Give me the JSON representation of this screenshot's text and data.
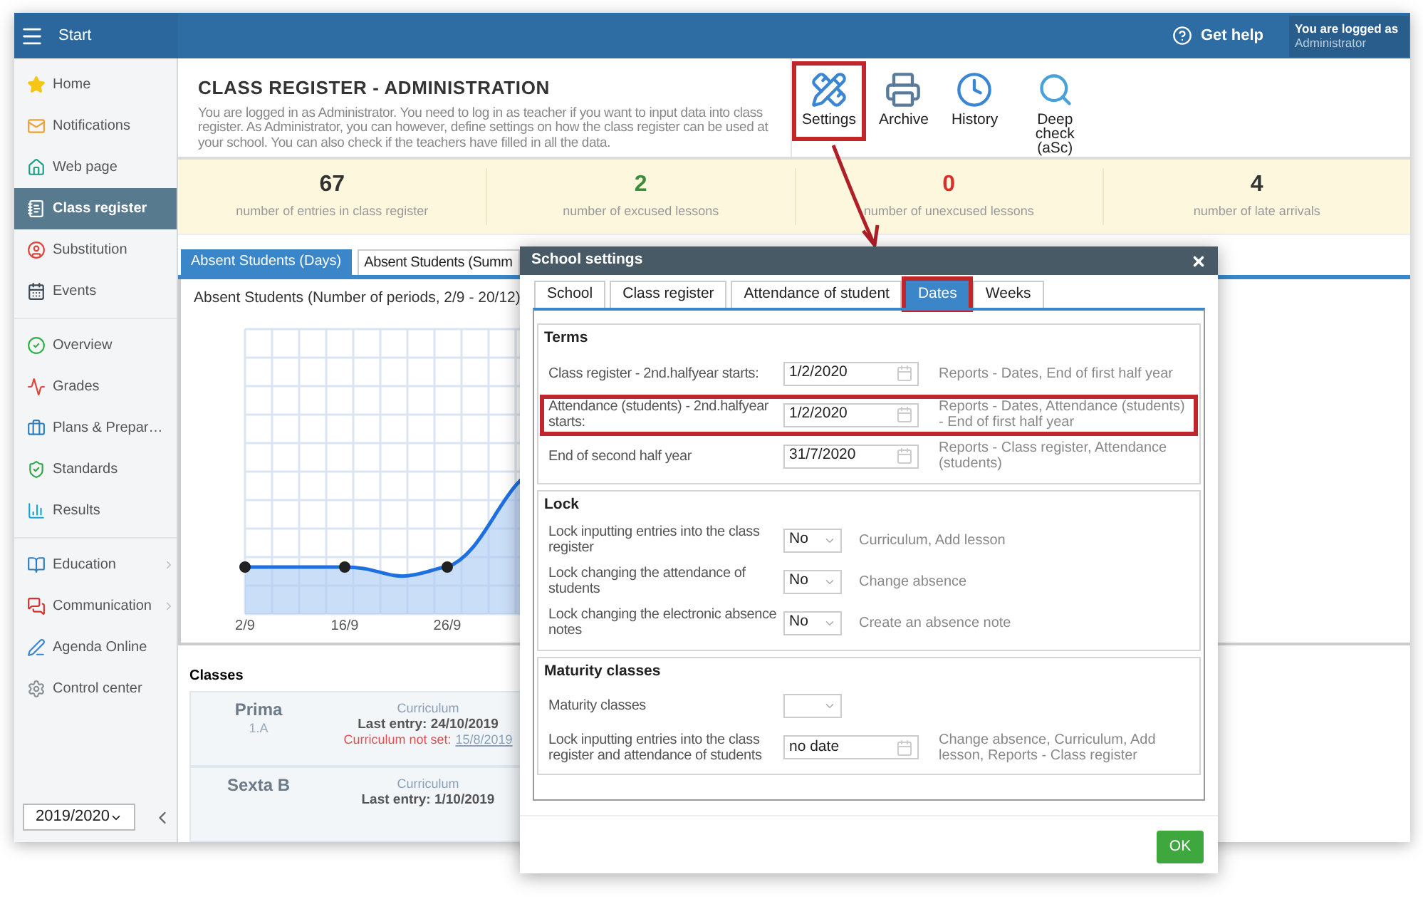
{
  "app_bar": {
    "title": "Start",
    "help": "Get help",
    "login_label": "You are logged as",
    "login_user": "Administrator"
  },
  "sidebar": {
    "groups": [
      [
        {
          "label": "Home",
          "selected": false,
          "has_submenu": false
        },
        {
          "label": "Notifications",
          "selected": false,
          "has_submenu": false
        },
        {
          "label": "Web page",
          "selected": false,
          "has_submenu": false
        },
        {
          "label": "Class register",
          "selected": true,
          "has_submenu": false
        },
        {
          "label": "Substitution",
          "selected": false,
          "has_submenu": false
        },
        {
          "label": "Events",
          "selected": false,
          "has_submenu": false
        }
      ],
      [
        {
          "label": "Overview",
          "selected": false,
          "has_submenu": false
        },
        {
          "label": "Grades",
          "selected": false,
          "has_submenu": false
        },
        {
          "label": "Plans & Prepar…",
          "selected": false,
          "has_submenu": false
        },
        {
          "label": "Standards",
          "selected": false,
          "has_submenu": false
        },
        {
          "label": "Results",
          "selected": false,
          "has_submenu": false
        }
      ],
      [
        {
          "label": "Education",
          "selected": false,
          "has_submenu": true
        },
        {
          "label": "Communication",
          "selected": false,
          "has_submenu": true
        },
        {
          "label": "Agenda Online",
          "selected": false,
          "has_submenu": false
        },
        {
          "label": "Control center",
          "selected": false,
          "has_submenu": false
        }
      ]
    ],
    "year": "2019/2020"
  },
  "header": {
    "title": "CLASS REGISTER - ADMINISTRATION",
    "description": "You are logged in as Administrator. You need to log in as teacher if you want to input data into class register. As Administrator, you can however, define settings on how the class register can be used at your school. You can also check if the teachers have filled in all the data.",
    "tools": [
      {
        "label": "Settings",
        "highlighted": true
      },
      {
        "label": "Archive",
        "highlighted": false
      },
      {
        "label": "History",
        "highlighted": false
      },
      {
        "label": "Deep check (aSc)",
        "highlighted": false
      }
    ]
  },
  "stats": [
    {
      "value": "67",
      "label": "number of entries in class register",
      "color": "#333333"
    },
    {
      "value": "2",
      "label": "number of excused lessons",
      "color": "#3c8c3c"
    },
    {
      "value": "0",
      "label": "number of unexcused lessons",
      "color": "#d9302c"
    },
    {
      "value": "4",
      "label": "number of late arrivals",
      "color": "#333333"
    }
  ],
  "tabs": [
    {
      "label": "Absent Students (Days)",
      "selected": true
    },
    {
      "label": "Absent Students (Summ",
      "selected": false
    }
  ],
  "chart": {
    "title": "Absent Students (Number of periods, 2/9 - 20/12)",
    "x_labels": [
      "2/9",
      "16/9",
      "26/9"
    ]
  },
  "classes": {
    "title": "Classes",
    "rows": [
      {
        "name": "Prima",
        "code": "1.A",
        "type": "Curriculum",
        "last_entry": "Last entry: 24/10/2019",
        "warning": "Curriculum not set:",
        "warning_link": "15/8/2019"
      },
      {
        "name": "Sexta B",
        "type": "Curriculum",
        "last_entry": "Last entry: 1/10/2019"
      }
    ]
  },
  "dialog": {
    "title": "School settings",
    "tabs": [
      {
        "label": "School",
        "selected": false,
        "highlighted": false
      },
      {
        "label": "Class register",
        "selected": false,
        "highlighted": false
      },
      {
        "label": "Attendance of student",
        "selected": false,
        "highlighted": false
      },
      {
        "label": "Dates",
        "selected": true,
        "highlighted": true
      },
      {
        "label": "Weeks",
        "selected": false,
        "highlighted": false
      }
    ],
    "sections": [
      {
        "title": "Terms",
        "rows": [
          {
            "kind": "date",
            "label": "Class register - 2nd.halfyear starts:",
            "value": "1/2/2020",
            "note": "Reports - Dates, End of first half year",
            "highlighted": false
          },
          {
            "kind": "date",
            "label": "Attendance (students) - 2nd.halfyear starts:",
            "value": "1/2/2020",
            "note": "Reports - Dates, Attendance (students) - End of first half year",
            "highlighted": true
          },
          {
            "kind": "date",
            "label": "End of second half year",
            "value": "31/7/2020",
            "note": "Reports - Class register, Attendance (students)",
            "highlighted": false
          }
        ]
      },
      {
        "title": "Lock",
        "rows": [
          {
            "kind": "select",
            "label": "Lock inputting entries into the class register",
            "value": "No",
            "note": "Curriculum, Add lesson",
            "highlighted": false
          },
          {
            "kind": "select",
            "label": "Lock changing the attendance of students",
            "value": "No",
            "note": "Change absence",
            "highlighted": false
          },
          {
            "kind": "select",
            "label": "Lock changing the electronic absence notes",
            "value": "No",
            "note": "Create an absence note",
            "highlighted": false
          }
        ]
      },
      {
        "title": "Maturity classes",
        "rows": [
          {
            "kind": "select",
            "label": "Maturity classes",
            "highlighted": false
          },
          {
            "kind": "date",
            "label": "Lock inputting entries into the class register and attendance of students",
            "value": "no date",
            "note": "Change absence, Curriculum, Add lesson, Reports - Class register",
            "highlighted": false
          }
        ]
      }
    ],
    "ok": "OK"
  }
}
